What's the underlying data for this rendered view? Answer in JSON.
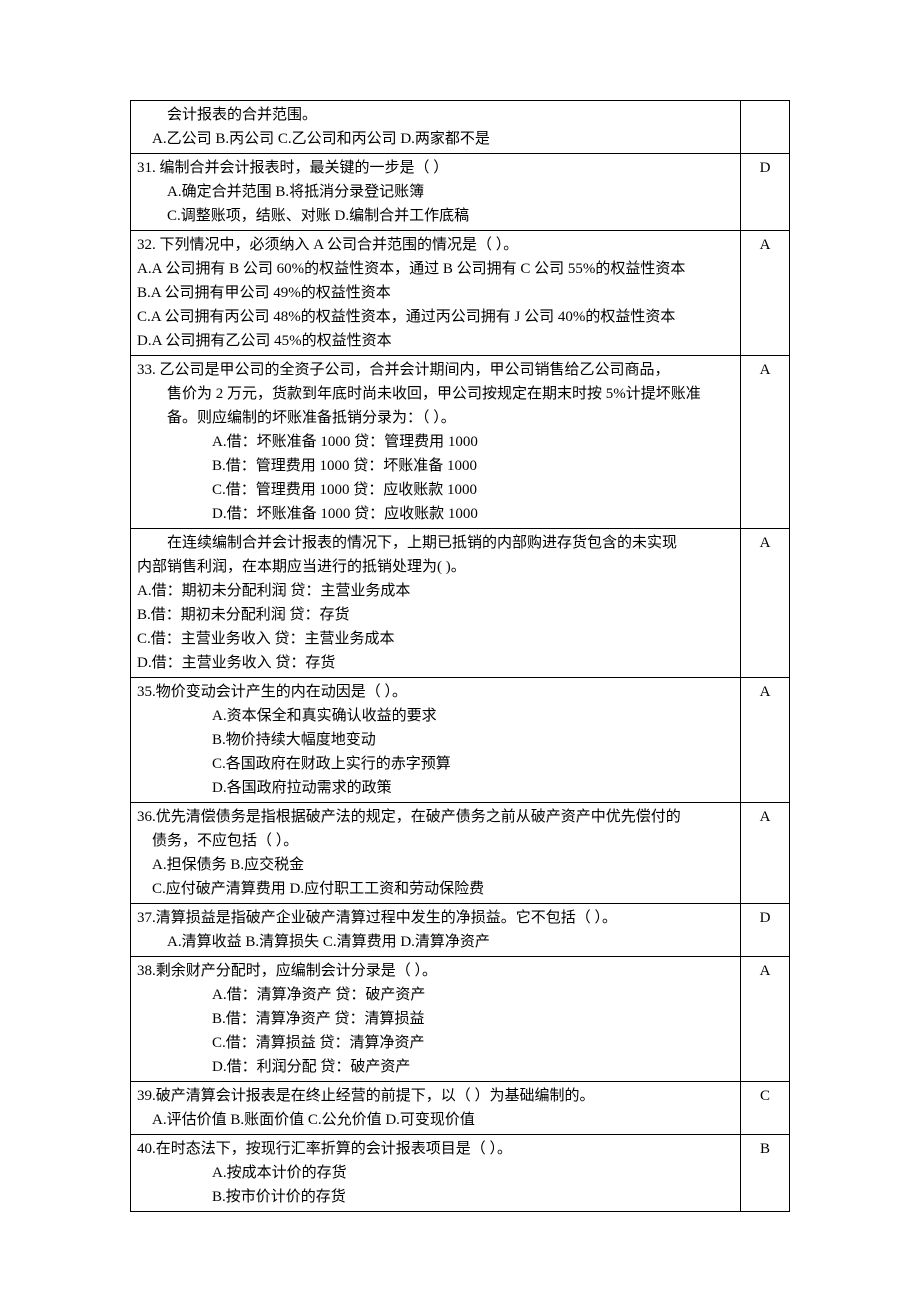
{
  "rows": [
    {
      "lines": [
        {
          "cls": "indent2",
          "text": "会计报表的合并范围。"
        },
        {
          "cls": "indent1",
          "text": "A.乙公司    B.丙公司    C.乙公司和丙公司    D.两家都不是"
        }
      ],
      "answer": ""
    },
    {
      "lines": [
        {
          "cls": "row-line",
          "text": "31. 编制合并会计报表时，最关键的一步是（    ）"
        },
        {
          "cls": "indent2",
          "text": "A.确定合并范围          B.将抵消分录登记账簿"
        },
        {
          "cls": "indent2",
          "text": "C.调整账项，结账、对账    D.编制合并工作底稿"
        }
      ],
      "answer": "D"
    },
    {
      "lines": [
        {
          "cls": "row-line",
          "text": "32. 下列情况中，必须纳入 A 公司合并范围的情况是（    ）。"
        },
        {
          "cls": "row-line",
          "text": "A.A 公司拥有 B 公司 60%的权益性资本，通过 B 公司拥有 C 公司 55%的权益性资本"
        },
        {
          "cls": "row-line",
          "text": "B.A 公司拥有甲公司 49%的权益性资本"
        },
        {
          "cls": "row-line",
          "text": "C.A 公司拥有丙公司 48%的权益性资本，通过丙公司拥有 J 公司 40%的权益性资本"
        },
        {
          "cls": "row-line",
          "text": "D.A 公司拥有乙公司 45%的权益性资本"
        }
      ],
      "answer": "A"
    },
    {
      "lines": [
        {
          "cls": "row-line",
          "text": "33. 乙公司是甲公司的全资子公司，合并会计期间内，甲公司销售给乙公司商品，"
        },
        {
          "cls": "indent2",
          "text": "售价为 2 万元，货款到年底时尚未收回，甲公司按规定在期末时按 5%计提坏账准"
        },
        {
          "cls": "indent2",
          "text": "备。则应编制的坏账准备抵销分录为：（    ）。"
        },
        {
          "cls": "indent4",
          "text": "A.借：坏账准备 1000  贷：管理费用 1000"
        },
        {
          "cls": "indent4",
          "text": "B.借：管理费用 1000  贷：坏账准备  1000"
        },
        {
          "cls": "indent4",
          "text": "C.借：管理费用 1000  贷：应收账款  1000"
        },
        {
          "cls": "indent4",
          "text": "D.借：坏账准备 1000  贷：应收账款  1000"
        }
      ],
      "answer": "A"
    },
    {
      "lines": [
        {
          "cls": "indent2",
          "text": "在连续编制合并会计报表的情况下，上期已抵销的内部购进存货包含的未实现"
        },
        {
          "cls": "row-line",
          "text": "内部销售利润，在本期应当进行的抵销处理为(    )。"
        },
        {
          "cls": "row-line",
          "text": "A.借：期初未分配利润 贷：主营业务成本"
        },
        {
          "cls": "row-line",
          "text": "B.借：期初未分配利润 贷：存货"
        },
        {
          "cls": "row-line",
          "text": "C.借：主营业务收入 贷：主营业务成本"
        },
        {
          "cls": "row-line",
          "text": "D.借：主营业务收入 贷：存货"
        }
      ],
      "answer": "A"
    },
    {
      "lines": [
        {
          "cls": "row-line",
          "text": "35.物价变动会计产生的内在动因是（    ）。"
        },
        {
          "cls": "indent4",
          "text": "A.资本保全和真实确认收益的要求"
        },
        {
          "cls": "indent4",
          "text": "B.物价持续大幅度地变动"
        },
        {
          "cls": "indent4",
          "text": "C.各国政府在财政上实行的赤字预算"
        },
        {
          "cls": "indent4",
          "text": "D.各国政府拉动需求的政策"
        }
      ],
      "answer": "A"
    },
    {
      "lines": [
        {
          "cls": "row-line",
          "text": "36.优先清偿债务是指根据破产法的规定，在破产债务之前从破产资产中优先偿付的"
        },
        {
          "cls": "indent1",
          "text": "债务，不应包括（    ）。"
        },
        {
          "cls": "indent1",
          "text": "A.担保债务            B.应交税金"
        },
        {
          "cls": "indent1",
          "text": "C.应付破产清算费用      D.应付职工工资和劳动保险费"
        }
      ],
      "answer": "A"
    },
    {
      "lines": [
        {
          "cls": "row-line",
          "text": "37.清算损益是指破产企业破产清算过程中发生的净损益。它不包括（    ）。"
        },
        {
          "cls": "indent2",
          "text": "A.清算收益    B.清算损失    C.清算费用    D.清算净资产"
        }
      ],
      "answer": "D"
    },
    {
      "lines": [
        {
          "cls": "row-line",
          "text": "38.剩余财产分配时，应编制会计分录是（    ）。"
        },
        {
          "cls": "indent4",
          "text": "A.借：清算净资产  贷：破产资产"
        },
        {
          "cls": "indent4",
          "text": "B.借：清算净资产  贷：清算损益"
        },
        {
          "cls": "indent4",
          "text": "C.借：清算损益  贷：清算净资产"
        },
        {
          "cls": "indent4",
          "text": "D.借：利润分配  贷：破产资产"
        }
      ],
      "answer": "A"
    },
    {
      "lines": [
        {
          "cls": "row-line",
          "text": "39.破产清算会计报表是在终止经营的前提下，以（    ）为基础编制的。"
        },
        {
          "cls": "indent1",
          "text": "A.评估价值    B.账面价值    C.公允价值    D.可变现价值"
        }
      ],
      "answer": "C"
    },
    {
      "lines": [
        {
          "cls": "row-line",
          "text": "40.在时态法下，按现行汇率折算的会计报表项目是（    ）。"
        },
        {
          "cls": "indent4",
          "text": "A.按成本计价的存货"
        },
        {
          "cls": "indent4",
          "text": "B.按市价计价的存货"
        }
      ],
      "answer": "B"
    }
  ]
}
